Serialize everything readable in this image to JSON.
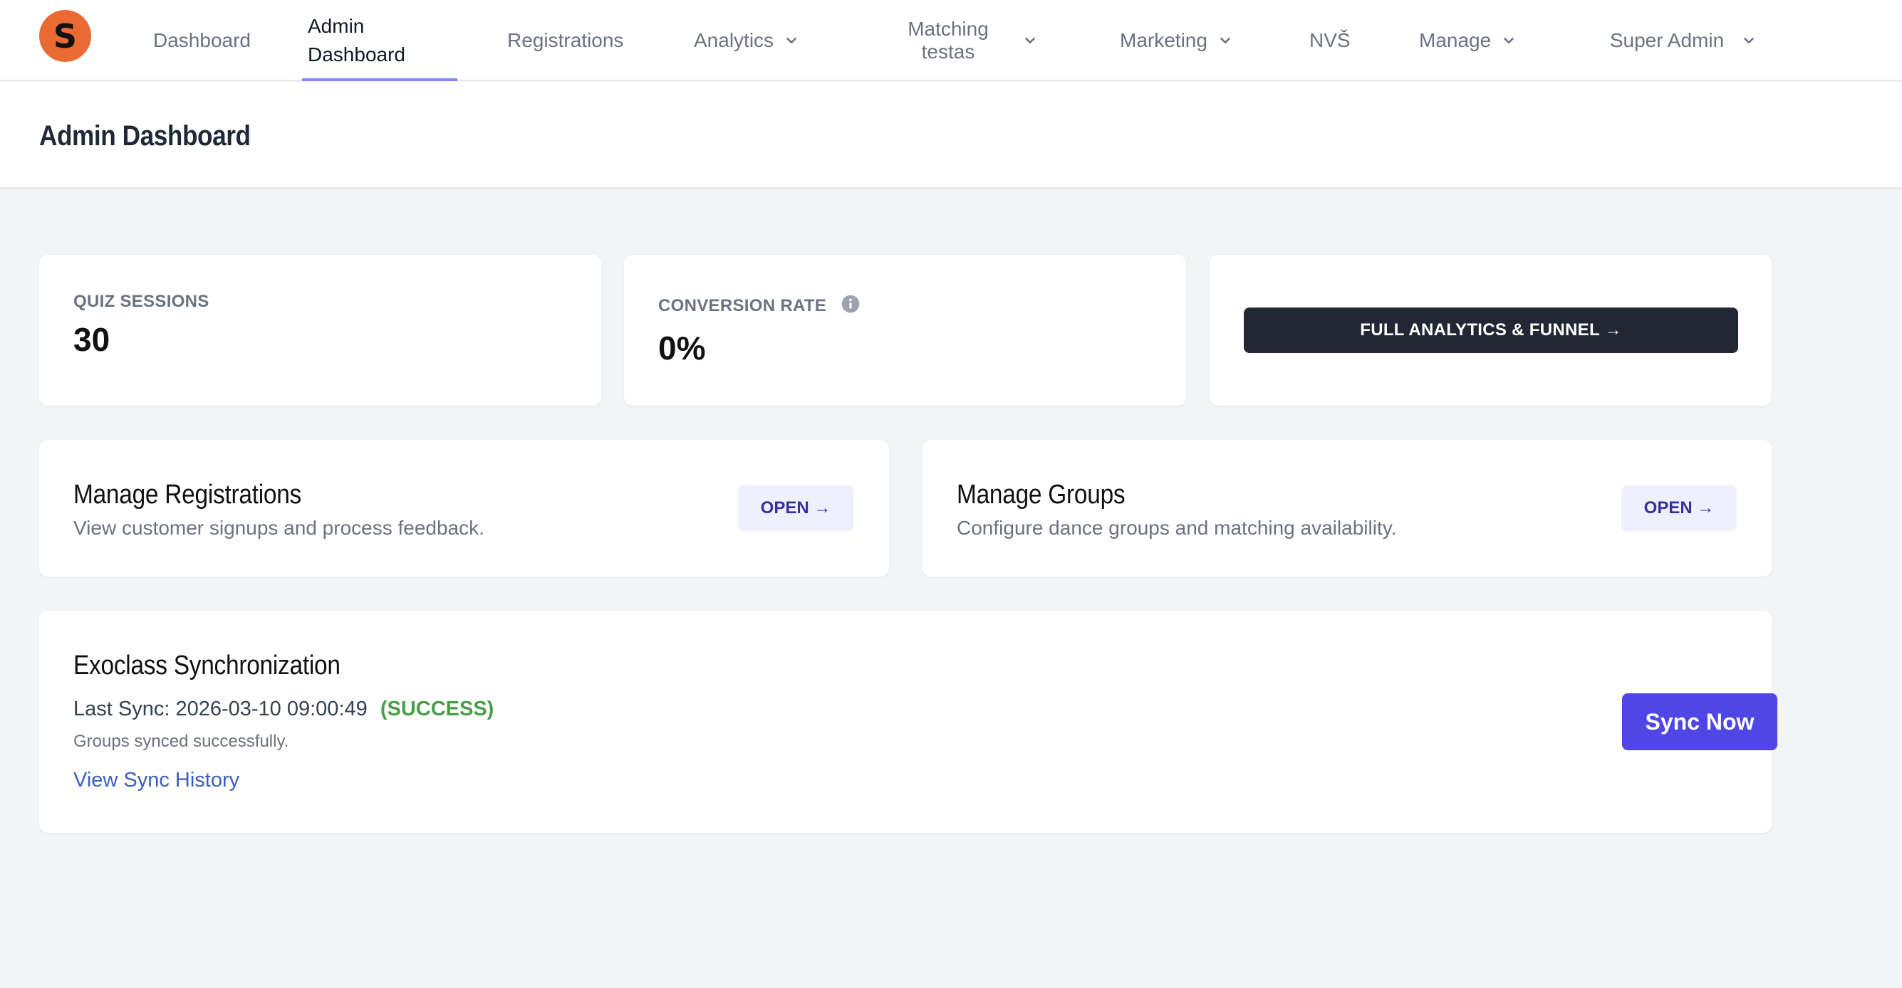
{
  "brand": {
    "logo_letter": "S",
    "logo_color": "#ea6a34"
  },
  "nav": {
    "dashboard": "Dashboard",
    "admin_dashboard": "Admin Dashboard",
    "registrations": "Registrations",
    "analytics": "Analytics",
    "matching": "Matching testas",
    "marketing": "Marketing",
    "nvs": "NVŠ",
    "manage": "Manage",
    "super_admin": "Super Admin",
    "active": "admin_dashboard",
    "accent_color": "#818cf8"
  },
  "header": {
    "title": "Admin Dashboard"
  },
  "stats": {
    "quiz_sessions": {
      "label": "QUIZ SESSIONS",
      "value": "30"
    },
    "conversion_rate": {
      "label": "CONVERSION RATE",
      "value": "0%"
    },
    "analytics_button": "FULL ANALYTICS & FUNNEL →"
  },
  "manage_registrations": {
    "title": "Manage Registrations",
    "description": "View customer signups and process feedback.",
    "button": "OPEN →"
  },
  "manage_groups": {
    "title": "Manage Groups",
    "description": "Configure dance groups and matching availability.",
    "button": "OPEN →"
  },
  "sync": {
    "title": "Exoclass Synchronization",
    "last_sync_label": "Last Sync:",
    "last_sync_time": "2026-03-10 09:00:49",
    "status": "(SUCCESS)",
    "status_color": "#4a9e4a",
    "note": "Groups synced successfully.",
    "history_link": "View Sync History",
    "button": "Sync Now",
    "button_color": "#4f46e5"
  }
}
